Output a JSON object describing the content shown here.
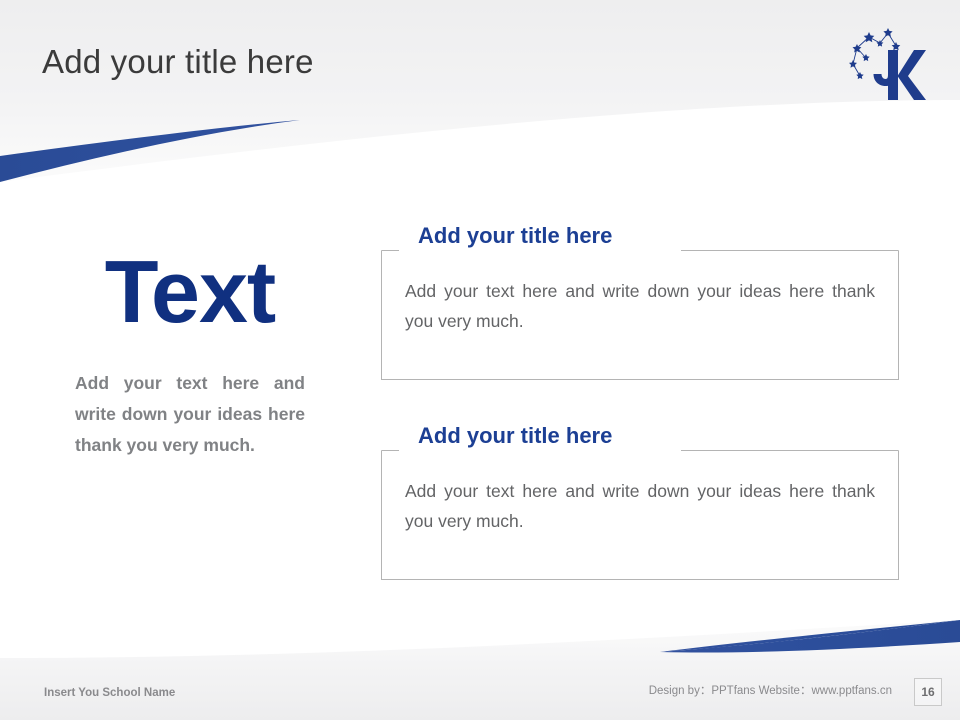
{
  "slide": {
    "title": "Add your title here",
    "page_number": "16",
    "accent_blue": "#2d4f9c",
    "heading_blue": "#1c3f94",
    "big_text_blue": "#103080",
    "body_gray": "#636466",
    "left_body_gray": "#808285"
  },
  "logo": {
    "name": "university-k-star-logo",
    "letter": "K"
  },
  "left_column": {
    "big_text": "Text",
    "body": "Add your text here and write down your ideas here thank you very much."
  },
  "panels": [
    {
      "title": "Add your title here",
      "body": "Add your text here and write down your ideas here thank you very much."
    },
    {
      "title": "Add your title here",
      "body": "Add your text here and write down your ideas here thank you very much."
    }
  ],
  "footer": {
    "school_name": "Insert You School Name",
    "credits": "Design by：PPTfans  Website：www.pptfans.cn"
  }
}
